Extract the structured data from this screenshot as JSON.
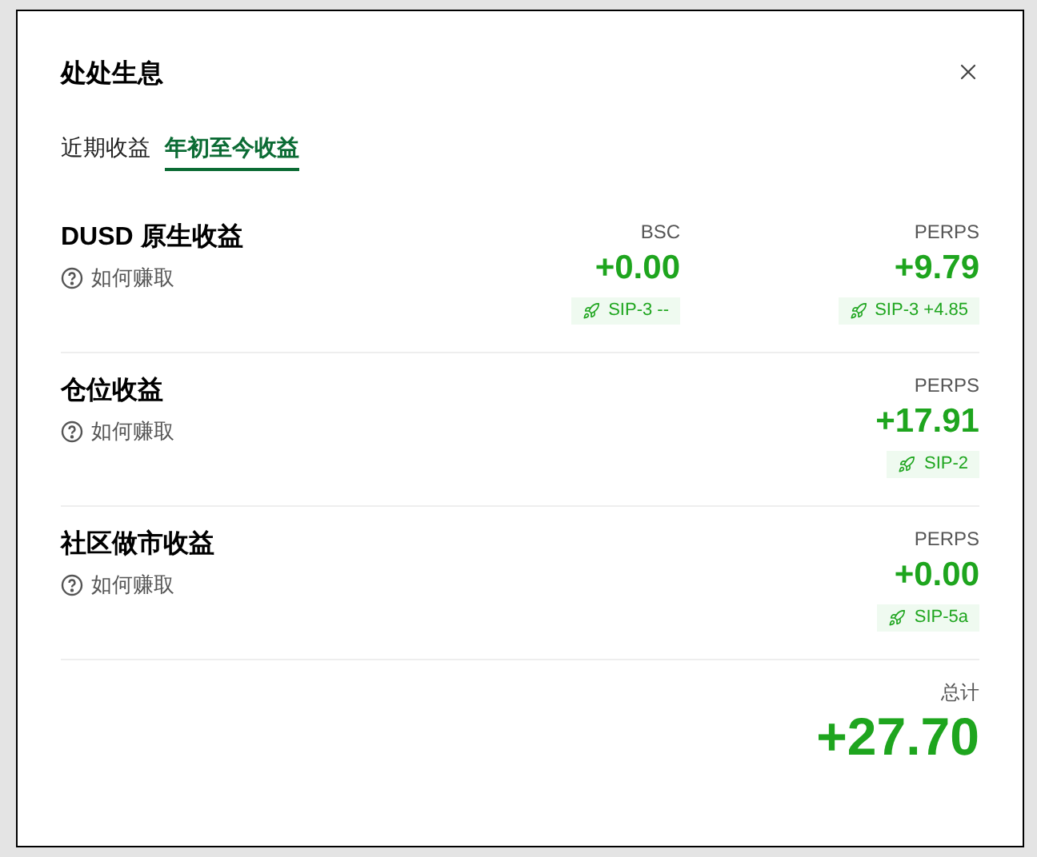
{
  "dialog": {
    "title": "处处生息"
  },
  "tabs": [
    {
      "label": "近期收益",
      "selected": false
    },
    {
      "label": "年初至今收益",
      "selected": true
    }
  ],
  "sections": [
    {
      "title": "DUSD 原生收益",
      "help": "如何赚取",
      "sources": [
        {
          "chain": "BSC",
          "value": "+0.00",
          "tag": "SIP-3 --"
        },
        {
          "chain": "PERPS",
          "value": "+9.79",
          "tag": "SIP-3 +4.85"
        }
      ]
    },
    {
      "title": "仓位收益",
      "help": "如何赚取",
      "sources": [
        {
          "chain": "PERPS",
          "value": "+17.91",
          "tag": "SIP-2"
        }
      ]
    },
    {
      "title": "社区做市收益",
      "help": "如何赚取",
      "sources": [
        {
          "chain": "PERPS",
          "value": "+0.00",
          "tag": "SIP-5a"
        }
      ]
    }
  ],
  "total": {
    "label": "总计",
    "value": "+27.70"
  }
}
